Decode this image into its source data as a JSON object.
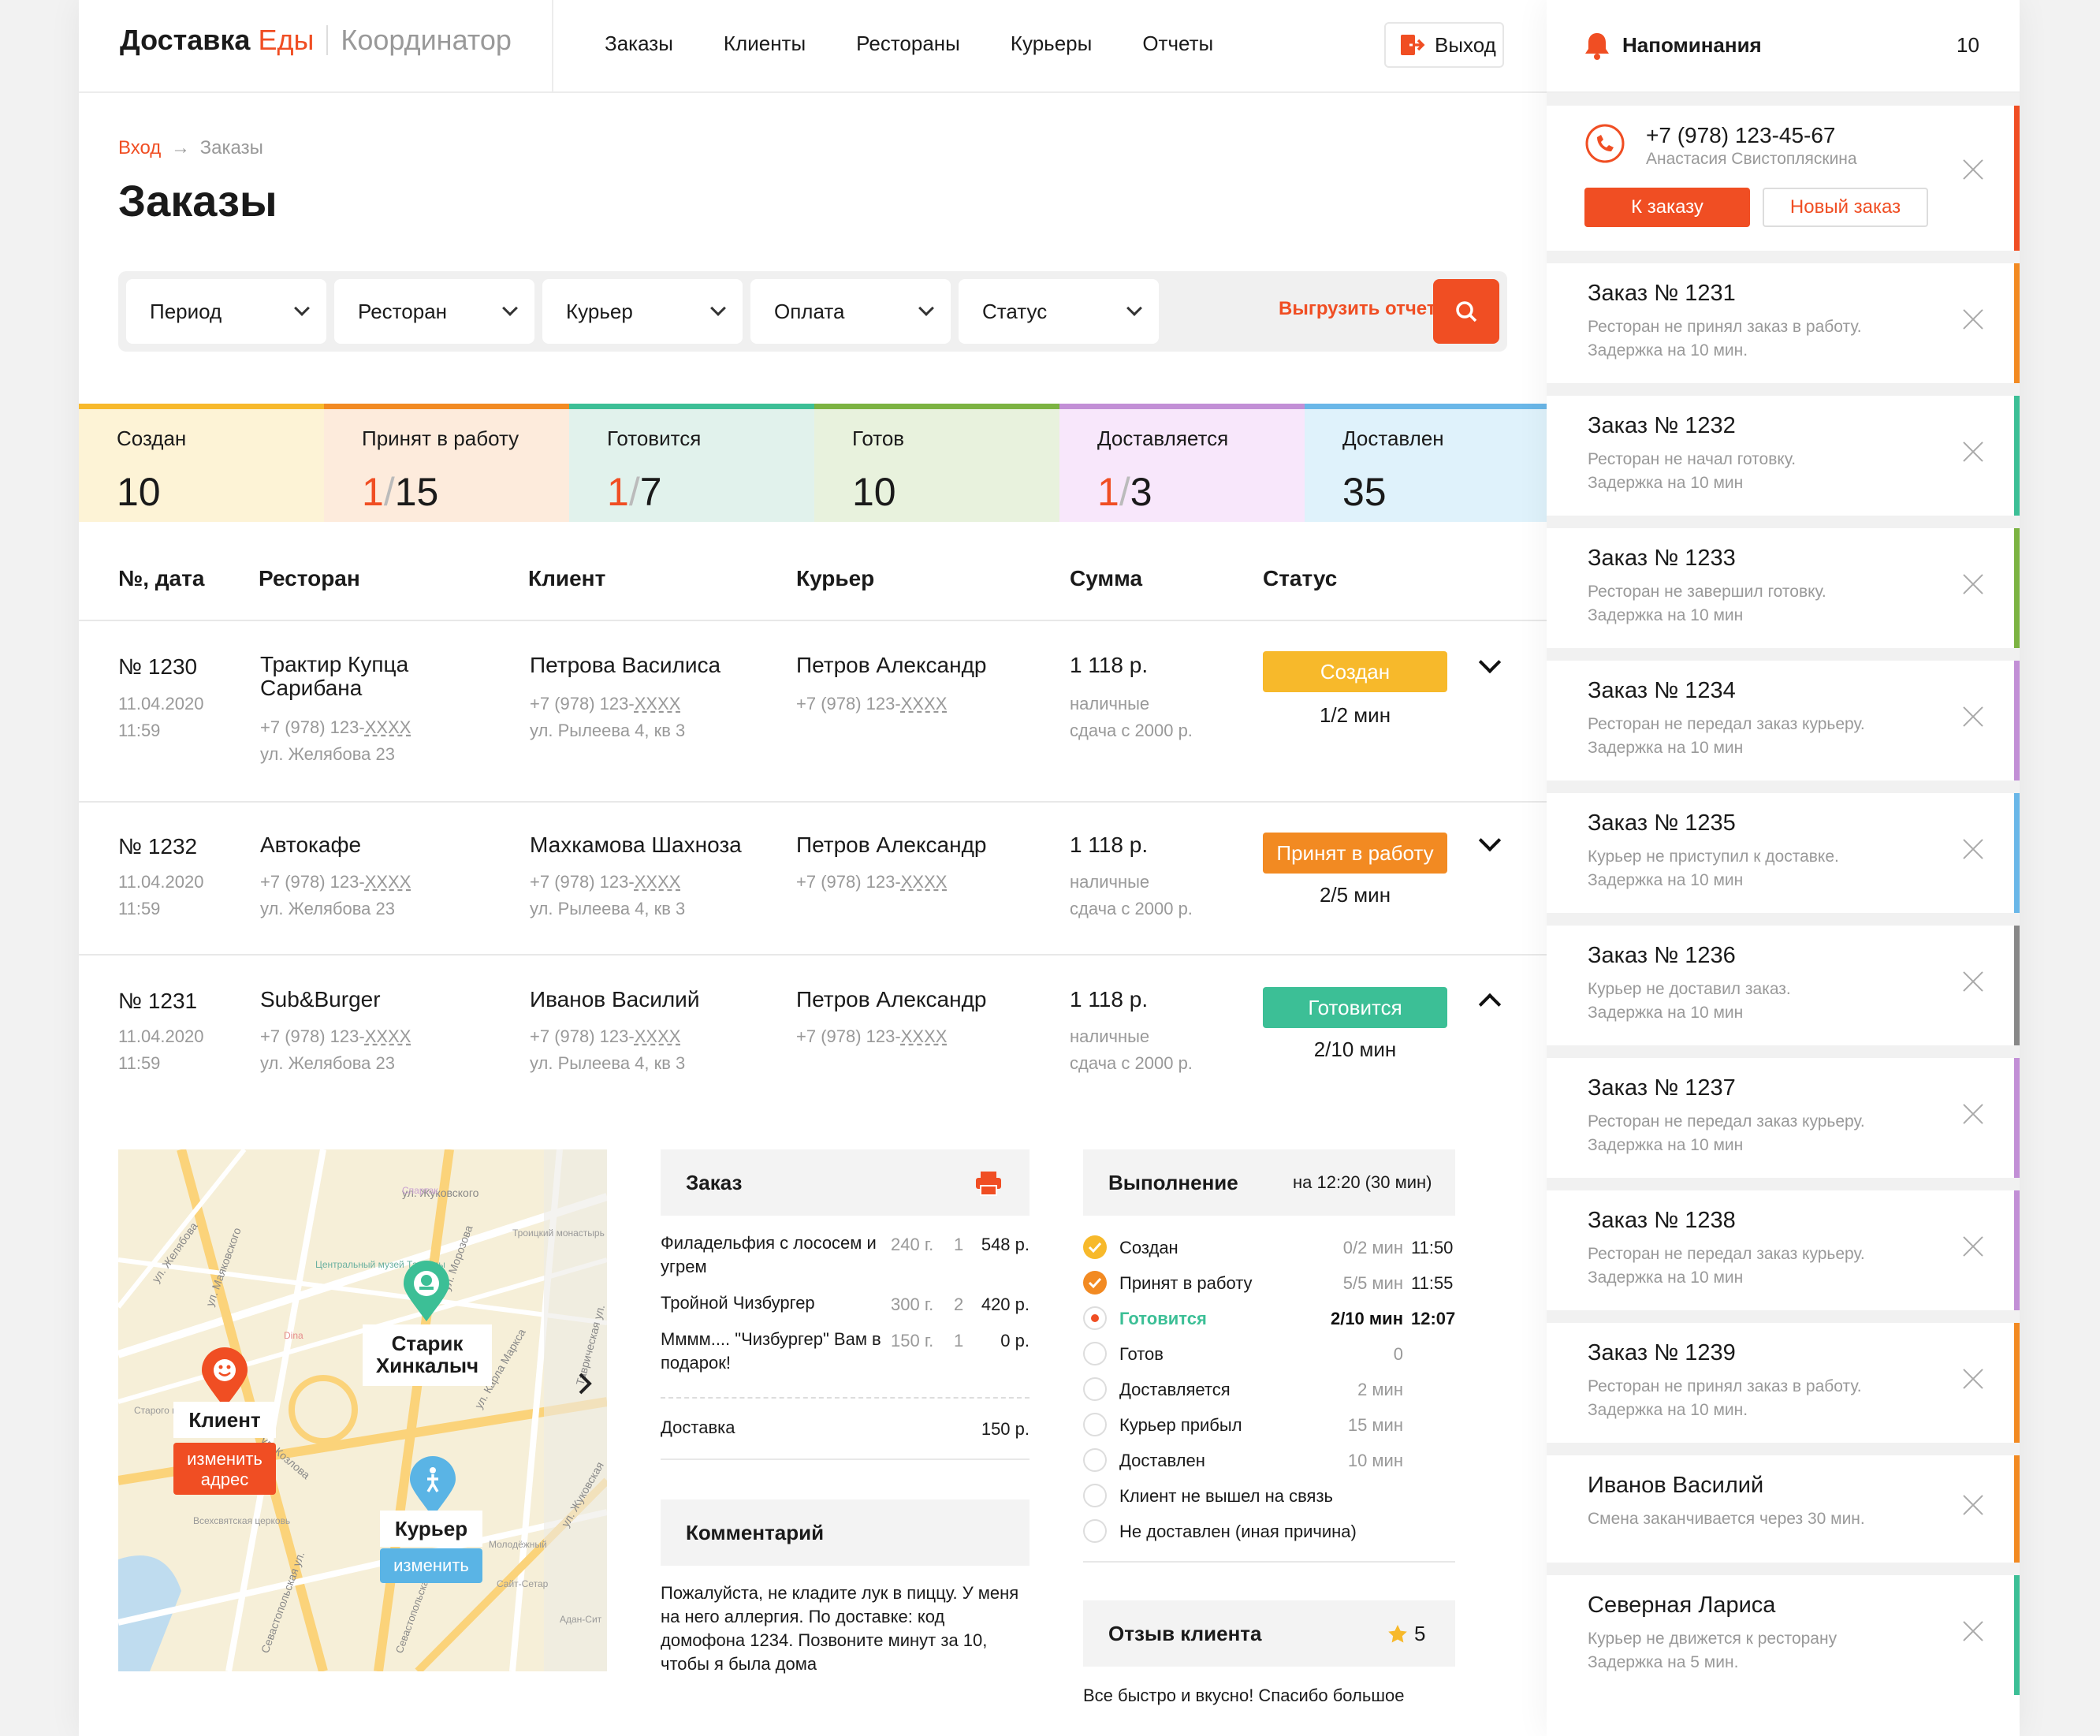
{
  "header": {
    "logo_part1": "Доставка",
    "logo_part2": "Еды",
    "logo_part3": "Координатор",
    "nav": [
      "Заказы",
      "Клиенты",
      "Рестораны",
      "Курьеры",
      "Отчеты"
    ],
    "logout_label": "Выход"
  },
  "breadcrumb": {
    "home": "Вход",
    "arrow": "→",
    "current": "Заказы"
  },
  "page_title": "Заказы",
  "filters": {
    "items": [
      "Период",
      "Ресторан",
      "Курьер",
      "Оплата",
      "Статус"
    ],
    "export_label": "Выгрузить отчет"
  },
  "stats": [
    {
      "label": "Создан",
      "value": "10",
      "color": "#f7b92b"
    },
    {
      "label": "Принят в работу",
      "late": "1",
      "total": "15",
      "color": "#f28a22"
    },
    {
      "label": "Готовится",
      "late": "1",
      "total": "7",
      "color": "#3cbf96"
    },
    {
      "label": "Готов",
      "value": "10",
      "color": "#7cb342"
    },
    {
      "label": "Доставляется",
      "late": "1",
      "total": "3",
      "color": "#c28fd6"
    },
    {
      "label": "Доставлен",
      "value": "35",
      "color": "#6ab7e8"
    }
  ],
  "table": {
    "headers": [
      "№, дата",
      "Ресторан",
      "Клиент",
      "Курьер",
      "Сумма",
      "Статус"
    ],
    "rows": [
      {
        "num": "№ 1230",
        "date": "11.04.2020",
        "time": "11:59",
        "restaurant": "Трактир Купца Сарибана",
        "r_phone_pre": "+7 (978) 123-",
        "r_phone_mask": "XXXX",
        "r_addr": "ул. Желябова 23",
        "client": "Петрова Василиса",
        "c_phone_pre": "+7 (978) 123-",
        "c_phone_mask": "XXXX",
        "c_addr": "ул. Рылеева 4, кв 3",
        "courier": "Петров Александр",
        "k_phone_pre": "+7 (978) 123-",
        "k_phone_mask": "XXXX",
        "sum": "1 118 р.",
        "pay": "наличные",
        "change": "сдача с 2000 р.",
        "status": "Создан",
        "status_color": "#f7b92b",
        "timer": "1/2 мин"
      },
      {
        "num": "№ 1232",
        "date": "11.04.2020",
        "time": "11:59",
        "restaurant": "Автокафе",
        "r_phone_pre": "+7 (978) 123-",
        "r_phone_mask": "XXXX",
        "r_addr": "ул. Желябова 23",
        "client": "Махкамова Шахноза",
        "c_phone_pre": "+7 (978) 123-",
        "c_phone_mask": "XXXX",
        "c_addr": "ул. Рылеева 4, кв 3",
        "courier": "Петров Александр",
        "k_phone_pre": "+7 (978) 123-",
        "k_phone_mask": "XXXX",
        "sum": "1 118 р.",
        "pay": "наличные",
        "change": "сдача с 2000 р.",
        "status": "Принят в работу",
        "status_color": "#f28a22",
        "timer": "2/5 мин"
      },
      {
        "num": "№ 1231",
        "date": "11.04.2020",
        "time": "11:59",
        "restaurant": "Sub&Burger",
        "r_phone_pre": "+7 (978) 123-",
        "r_phone_mask": "XXXX",
        "r_addr": "ул. Желябова 23",
        "client": "Иванов Василий",
        "c_phone_pre": "+7 (978) 123-",
        "c_phone_mask": "XXXX",
        "c_addr": "ул. Рылеева 4, кв 3",
        "courier": "Петров Александр",
        "k_phone_pre": "+7 (978) 123-",
        "k_phone_mask": "XXXX",
        "sum": "1 118 р.",
        "pay": "наличные",
        "change": "сдача с 2000 р.",
        "status": "Готовится",
        "status_color": "#3cbf96",
        "timer": "2/10 мин"
      }
    ]
  },
  "map": {
    "client_label": "Клиент",
    "client_btn": "изменить адрес",
    "restaurant_label": "Старик Хинкалыч",
    "courier_label": "Курьер",
    "courier_btn": "изменить",
    "streets": [
      "ул. Жуковского",
      "ул. Желябова",
      "ул. Маяковского",
      "ул. Морозова",
      "ул. Козлова",
      "ул. Карла Маркса",
      "Севастопольская ул.",
      "Таврическая ул.",
      "ул. Жуковская",
      "Севастопольская пл."
    ],
    "pois": [
      "Спартак",
      "Центральный музей Тавриды",
      "Троицкий монастырь",
      "Dina",
      "Старого кладбища",
      "Всехсвятская церковь",
      "Молодёжный",
      "Сайт-Сетар",
      "Адан-Сит"
    ]
  },
  "order": {
    "title": "Заказ",
    "items": [
      {
        "name": "Филадельфия с лососем и угрем",
        "weight": "240 г.",
        "qty": "1",
        "price": "548 р."
      },
      {
        "name": "Тройной Чизбургер",
        "weight": "300 г.",
        "qty": "2",
        "price": "420 р."
      },
      {
        "name": "Мммм.... \"Чизбургер\" Вам в подарок!",
        "weight": "150 г.",
        "qty": "1",
        "price": "0 р."
      }
    ],
    "delivery_label": "Доставка",
    "delivery_price": "150 р.",
    "comment_title": "Комментарий",
    "comment": "Пожалуйста, не кладите лук в пиццу. У меня на него аллергия. По доставке: код домофона 1234. Позвоните минут за 10, чтобы я была дома"
  },
  "execution": {
    "title": "Выполнение",
    "subtitle": "на 12:20 (30 мин)",
    "steps": [
      {
        "label": "Создан",
        "dur": "0/2 мин",
        "time": "11:50",
        "state": "done",
        "color": "#f7b92b"
      },
      {
        "label": "Принят в работу",
        "dur": "5/5 мин",
        "time": "11:55",
        "state": "done",
        "color": "#f28a22"
      },
      {
        "label": "Готовится",
        "dur": "2/10 мин",
        "time": "12:07",
        "state": "active",
        "color": "#3cbf96"
      },
      {
        "label": "Готов",
        "dur": "0",
        "time": "",
        "state": "todo"
      },
      {
        "label": "Доставляется",
        "dur": "2 мин",
        "time": "",
        "state": "todo"
      },
      {
        "label": "Курьер прибыл",
        "dur": "15 мин",
        "time": "",
        "state": "todo"
      },
      {
        "label": "Доставлен",
        "dur": "10 мин",
        "time": "",
        "state": "todo"
      },
      {
        "label": "Клиент не вышел на связь",
        "dur": "",
        "time": "",
        "state": "todo"
      },
      {
        "label": "Не доставлен (иная причина)",
        "dur": "",
        "time": "",
        "state": "todo"
      }
    ],
    "review_title": "Отзыв клиента",
    "rating": "5",
    "review_text": "Все быстро и вкусно! Спасибо большое"
  },
  "reminders": {
    "title": "Напоминания",
    "count": "10",
    "call": {
      "phone": "+7 (978) 123-45-67",
      "name": "Анастасия Свистопляскина",
      "btn_order": "К заказу",
      "btn_new": "Новый заказ"
    },
    "items": [
      {
        "title": "Заказ № 1231",
        "line1": "Ресторан не принял заказ в работу.",
        "line2": "Задержка на 10 мин.",
        "color": "#f28a22"
      },
      {
        "title": "Заказ № 1232",
        "line1": "Ресторан не начал готовку.",
        "line2": "Задержка на 10 мин",
        "color": "#3cbf96"
      },
      {
        "title": "Заказ № 1233",
        "line1": "Ресторан не завершил готовку.",
        "line2": "Задержка на 10 мин",
        "color": "#7cb342"
      },
      {
        "title": "Заказ № 1234",
        "line1": "Ресторан не передал заказ курьеру.",
        "line2": "Задержка на 10 мин",
        "color": "#c28fd6"
      },
      {
        "title": "Заказ № 1235",
        "line1": "Курьер не приступил к доставке.",
        "line2": "Задержка на 10 мин",
        "color": "#6ab7e8"
      },
      {
        "title": "Заказ № 1236",
        "line1": "Курьер не доставил заказ.",
        "line2": "Задержка на 10 мин",
        "color": "#888888"
      },
      {
        "title": "Заказ № 1237",
        "line1": "Ресторан не передал заказ курьеру.",
        "line2": "Задержка на 10 мин",
        "color": "#c28fd6"
      },
      {
        "title": "Заказ № 1238",
        "line1": "Ресторан не передал заказ курьеру.",
        "line2": "Задержка на 10 мин",
        "color": "#c28fd6"
      },
      {
        "title": "Заказ № 1239",
        "line1": "Ресторан не принял заказ в работу.",
        "line2": "Задержка на 10 мин.",
        "color": "#f28a22"
      },
      {
        "title": "Иванов Василий",
        "line1": "Смена заканчивается через 30 мин.",
        "line2": "",
        "color": "#f28a22"
      },
      {
        "title": "Северная Лариса",
        "line1": "Курьер не движется к ресторану",
        "line2": "Задержка на 5 мин.",
        "color": "#3cbf96"
      }
    ]
  }
}
